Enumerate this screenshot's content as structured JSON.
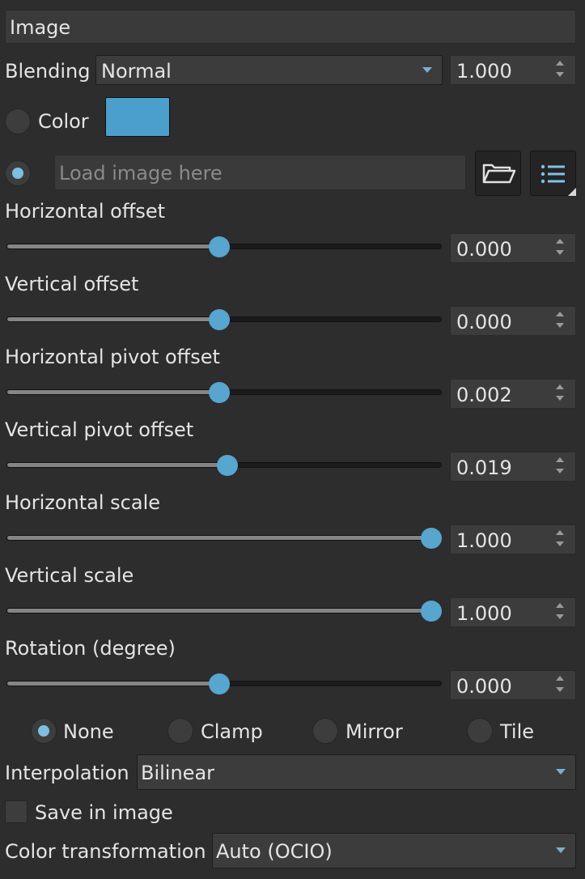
{
  "section": {
    "title": "Image"
  },
  "blending": {
    "label": "Blending",
    "mode": "Normal",
    "opacity": "1.000"
  },
  "source": {
    "color_label": "Color",
    "color_value": "#4b9fcc",
    "color_selected": false,
    "image_selected": true,
    "image_placeholder": "Load image here"
  },
  "sliders": [
    {
      "label": "Horizontal offset",
      "value": "0.000",
      "fraction": 0.5
    },
    {
      "label": "Vertical offset",
      "value": "0.000",
      "fraction": 0.5
    },
    {
      "label": "Horizontal pivot offset",
      "value": "0.002",
      "fraction": 0.5
    },
    {
      "label": "Vertical pivot offset",
      "value": "0.019",
      "fraction": 0.519
    },
    {
      "label": "Horizontal scale",
      "value": "1.000",
      "fraction": 1.0
    },
    {
      "label": "Vertical scale",
      "value": "1.000",
      "fraction": 1.0
    },
    {
      "label": "Rotation (degree)",
      "value": "0.000",
      "fraction": 0.5
    }
  ],
  "wrap_modes": [
    {
      "label": "None",
      "selected": true
    },
    {
      "label": "Clamp",
      "selected": false
    },
    {
      "label": "Mirror",
      "selected": false
    },
    {
      "label": "Tile",
      "selected": false
    }
  ],
  "interpolation": {
    "label": "Interpolation",
    "value": "Bilinear"
  },
  "save_in_image": {
    "label": "Save in image",
    "checked": false
  },
  "color_transformation": {
    "label": "Color transformation",
    "value": "Auto (OCIO)"
  },
  "colors": {
    "accent": "#56a6cf",
    "background": "#2d2d2d",
    "field": "#3c3c3c"
  }
}
